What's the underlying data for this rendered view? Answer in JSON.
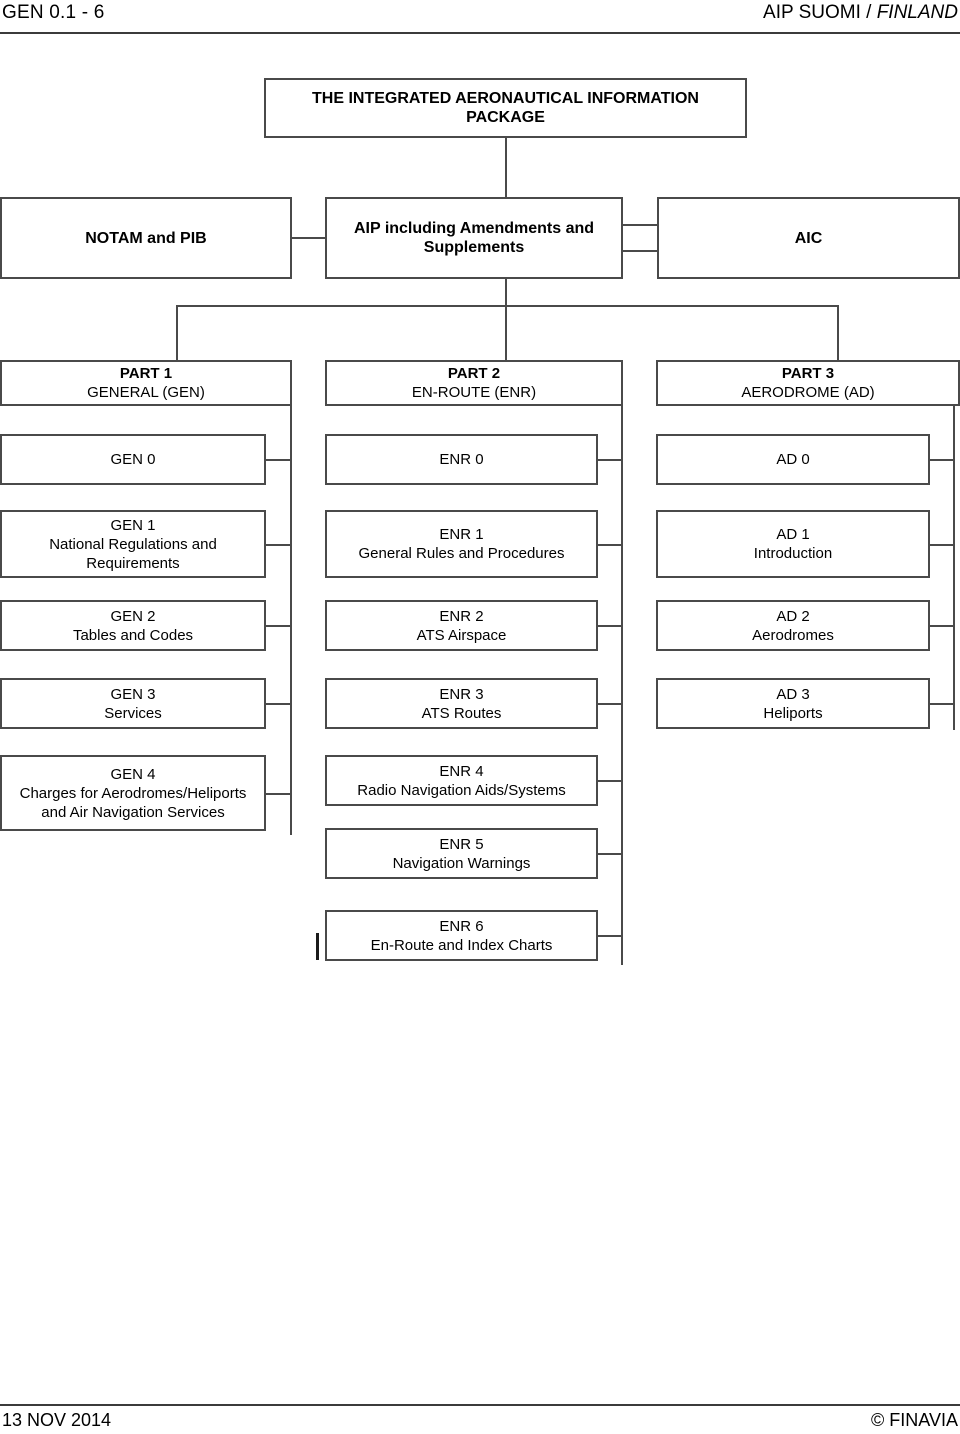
{
  "header": {
    "left": "GEN 0.1 - 6",
    "right_prefix": "AIP SUOMI / ",
    "right_italic": "FINLAND"
  },
  "footer": {
    "date": "13 NOV 2014",
    "copyright": "© FINAVIA"
  },
  "diagram": {
    "title": "THE INTEGRATED AERONAUTICAL INFORMATION PACKAGE",
    "row2": {
      "notam": "NOTAM and PIB",
      "aip_line1": "AIP including Amendments and",
      "aip_line2": "Supplements",
      "aic": "AIC"
    },
    "parts": [
      {
        "line1": "PART 1",
        "line2": "GENERAL (GEN)"
      },
      {
        "line1": "PART 2",
        "line2": "EN-ROUTE (ENR)"
      },
      {
        "line1": "PART 3",
        "line2": "AERODROME (AD)"
      }
    ],
    "gen": [
      {
        "line1": "GEN 0",
        "line2": "",
        "line3": ""
      },
      {
        "line1": "GEN 1",
        "line2": "National Regulations and",
        "line3": "Requirements"
      },
      {
        "line1": "GEN 2",
        "line2": "Tables and Codes",
        "line3": ""
      },
      {
        "line1": "GEN 3",
        "line2": "Services",
        "line3": ""
      },
      {
        "line1": "GEN 4",
        "line2": "Charges for Aerodromes/Heliports",
        "line3": "and Air Navigation Services"
      }
    ],
    "enr": [
      {
        "line1": "ENR 0",
        "line2": "",
        "line3": ""
      },
      {
        "line1": "ENR 1",
        "line2": "General Rules and Procedures",
        "line3": ""
      },
      {
        "line1": "ENR 2",
        "line2": "ATS Airspace",
        "line3": ""
      },
      {
        "line1": "ENR 3",
        "line2": "ATS Routes",
        "line3": ""
      },
      {
        "line1": "ENR 4",
        "line2": "Radio Navigation Aids/Systems",
        "line3": ""
      },
      {
        "line1": "ENR 5",
        "line2": "Navigation Warnings",
        "line3": ""
      },
      {
        "line1": "ENR 6",
        "line2": "En-Route and Index Charts",
        "line3": ""
      }
    ],
    "ad": [
      {
        "line1": "AD 0",
        "line2": "",
        "line3": ""
      },
      {
        "line1": "AD 1",
        "line2": "Introduction",
        "line3": ""
      },
      {
        "line1": "AD 2",
        "line2": "Aerodromes",
        "line3": ""
      },
      {
        "line1": "AD 3",
        "line2": "Heliports",
        "line3": ""
      }
    ],
    "colors": {
      "border": "#4a4a4a",
      "text": "#000000",
      "background": "#ffffff"
    }
  }
}
